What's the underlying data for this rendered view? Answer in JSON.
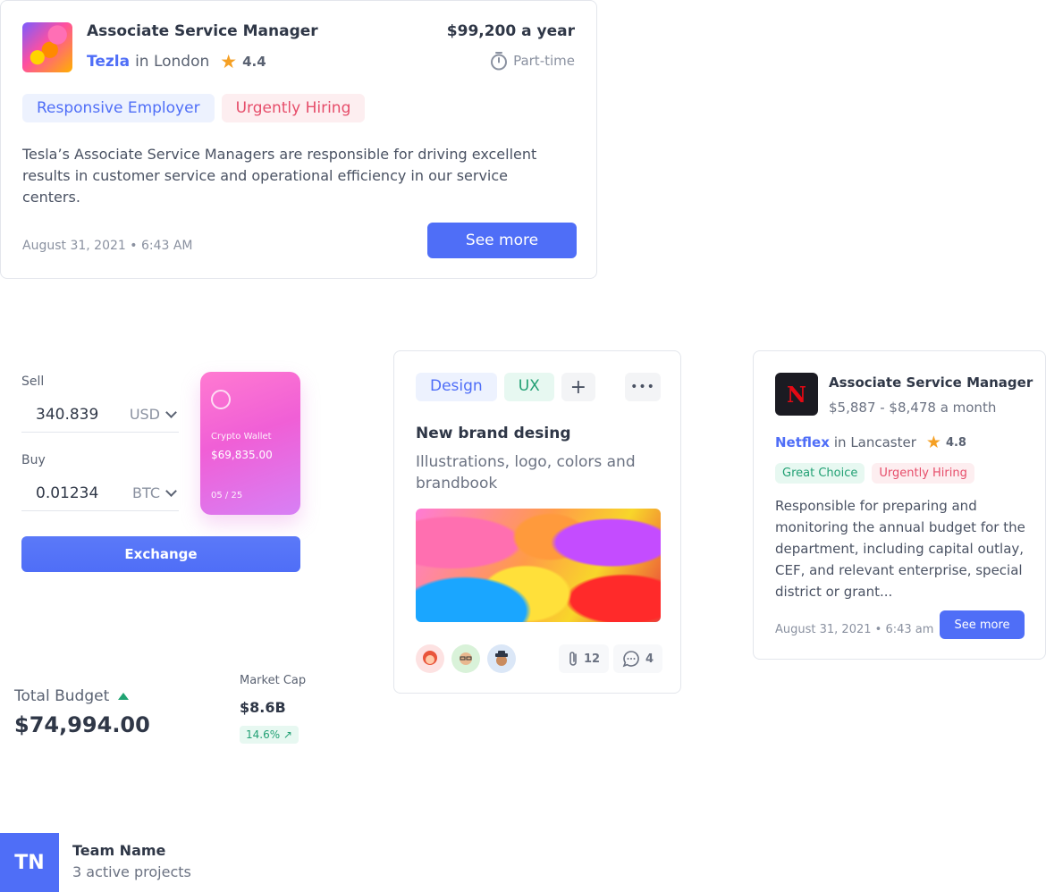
{
  "job_card_1": {
    "logo_icon": "colorful-abstract-logo",
    "title": "Associate Service Manager",
    "company": "Tezla",
    "location": "in London",
    "rating": "4.4",
    "salary": "$99,200 a year",
    "job_type": "Part-time",
    "tags": [
      "Responsive Employer",
      "Urgently Hiring"
    ],
    "description": "Tesla’s Associate Service Managers are responsible for driving excellent results in customer service and operational efficiency in our service centers.",
    "date": "August 31, 2021 • 6:43 AM",
    "button_label": "See more"
  },
  "exchange": {
    "sell_label": "Sell",
    "sell_amount": "340.839",
    "sell_currency": "USD",
    "buy_label": "Buy",
    "buy_amount": "0.01234",
    "buy_currency": "BTC",
    "wallet_name": "Crypto Wallet",
    "wallet_balance": "$69,835.00",
    "wallet_expiry": "05 / 25",
    "button_label": "Exchange",
    "wallet_color": "#f05fd6"
  },
  "budget": {
    "label": "Total Budget",
    "value": "$74,994.00",
    "trend": "up",
    "market_cap_label": "Market Cap",
    "market_cap_value": "$8.6B",
    "market_cap_change": "14.6% ↗"
  },
  "project_card": {
    "tags": [
      "Design",
      "UX"
    ],
    "title": "New brand desing",
    "description": "Illustrations, logo, colors and brandbook",
    "attachments": "12",
    "comments": "4",
    "avatars": [
      "avatar-red-hair",
      "avatar-glasses",
      "avatar-hat"
    ]
  },
  "job_card_2": {
    "logo_letter": "N",
    "title": "Associate Service Manager",
    "salary": "$5,887 - $8,478 a month",
    "company": "Netflex",
    "location": "in Lancaster",
    "rating": "4.8",
    "tags": [
      "Great Choice",
      "Urgently Hiring"
    ],
    "description": "Responsible for preparing and monitoring the annual budget for the department, including capital outlay, CEF, and relevant enterprise, special district or grant...",
    "date": "August 31, 2021 • 6:43 am",
    "button_label": "See more"
  },
  "team": {
    "initials": "TN",
    "name": "Team Name",
    "subtitle": "3 active projects"
  },
  "colors": {
    "accent": "#4f6ef7",
    "star": "#f5a024",
    "urgent": "#e64d6a",
    "positive": "#22a074"
  }
}
